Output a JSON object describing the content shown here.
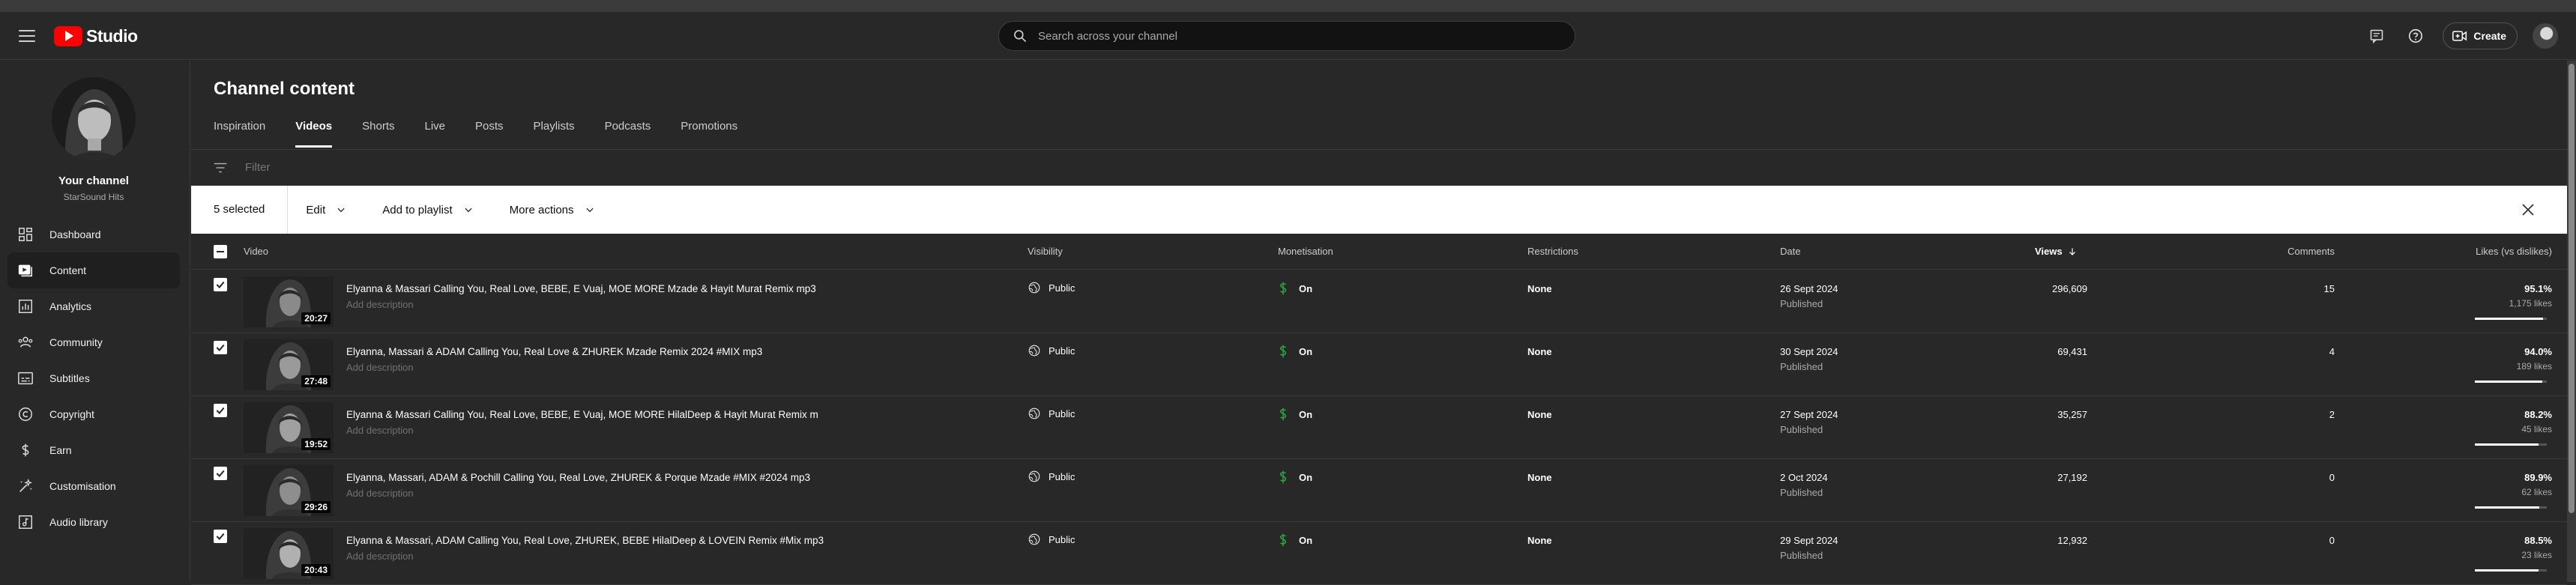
{
  "header": {
    "logo_text": "Studio",
    "search_placeholder": "Search across your channel",
    "create_label": "Create"
  },
  "sidebar": {
    "channel_title": "Your channel",
    "channel_name": "StarSound Hits",
    "items": [
      {
        "label": "Dashboard",
        "icon": "dashboard-icon"
      },
      {
        "label": "Content",
        "icon": "content-icon",
        "active": true
      },
      {
        "label": "Analytics",
        "icon": "analytics-icon"
      },
      {
        "label": "Community",
        "icon": "community-icon"
      },
      {
        "label": "Subtitles",
        "icon": "subtitles-icon"
      },
      {
        "label": "Copyright",
        "icon": "copyright-icon"
      },
      {
        "label": "Earn",
        "icon": "earn-icon"
      },
      {
        "label": "Customisation",
        "icon": "customisation-icon"
      },
      {
        "label": "Audio library",
        "icon": "audio-library-icon"
      }
    ]
  },
  "main": {
    "title": "Channel content",
    "tabs": [
      "Inspiration",
      "Videos",
      "Shorts",
      "Live",
      "Posts",
      "Playlists",
      "Podcasts",
      "Promotions"
    ],
    "active_tab": "Videos",
    "filter_placeholder": "Filter",
    "selection": {
      "count_label": "5 selected",
      "edit_label": "Edit",
      "playlist_label": "Add to playlist",
      "more_label": "More actions"
    },
    "columns": {
      "video": "Video",
      "visibility": "Visibility",
      "monetisation": "Monetisation",
      "restrictions": "Restrictions",
      "date": "Date",
      "views": "Views",
      "comments": "Comments",
      "likes": "Likes (vs dislikes)"
    },
    "rows": [
      {
        "title": "Elyanna & Massari Calling You, Real Love, BEBE, E Vuaj, MOE MORE Mzade & Hayit Murat Remix mp3",
        "desc": "Add description",
        "duration": "20:27",
        "visibility": "Public",
        "monetisation": "On",
        "restrictions": "None",
        "date": "26 Sept 2024",
        "status": "Published",
        "views": "296,609",
        "comments": "15",
        "likes_pct": "95.1%",
        "likes": "1,175 likes",
        "ratio": 0.951
      },
      {
        "title": "Elyanna, Massari & ADAM Calling You, Real Love & ZHUREK Mzade Remix 2024 #MIX mp3",
        "desc": "Add description",
        "duration": "27:48",
        "visibility": "Public",
        "monetisation": "On",
        "restrictions": "None",
        "date": "30 Sept 2024",
        "status": "Published",
        "views": "69,431",
        "comments": "4",
        "likes_pct": "94.0%",
        "likes": "189 likes",
        "ratio": 0.94
      },
      {
        "title": "Elyanna & Massari Calling You, Real Love, BEBE, E Vuaj, MOE MORE HilalDeep & Hayit Murat Remix m",
        "desc": "Add description",
        "duration": "19:52",
        "visibility": "Public",
        "monetisation": "On",
        "restrictions": "None",
        "date": "27 Sept 2024",
        "status": "Published",
        "views": "35,257",
        "comments": "2",
        "likes_pct": "88.2%",
        "likes": "45 likes",
        "ratio": 0.882
      },
      {
        "title": "Elyanna, Massari, ADAM & Pochill Calling You, Real Love, ZHUREK & Porque Mzade #MIX #2024 mp3",
        "desc": "Add description",
        "duration": "29:26",
        "visibility": "Public",
        "monetisation": "On",
        "restrictions": "None",
        "date": "2 Oct 2024",
        "status": "Published",
        "views": "27,192",
        "comments": "0",
        "likes_pct": "89.9%",
        "likes": "62 likes",
        "ratio": 0.899
      },
      {
        "title": "Elyanna & Massari, ADAM Calling You, Real Love, ZHUREK, BEBE HilalDeep & LOVEIN Remix #Mix mp3",
        "desc": "Add description",
        "duration": "20:43",
        "visibility": "Public",
        "monetisation": "On",
        "restrictions": "None",
        "date": "29 Sept 2024",
        "status": "Published",
        "views": "12,932",
        "comments": "0",
        "likes_pct": "88.5%",
        "likes": "23 likes",
        "ratio": 0.885
      }
    ]
  },
  "colors": {
    "background": "#282828",
    "monetisation_green": "#2ba640",
    "brand_red": "#ff0000"
  }
}
